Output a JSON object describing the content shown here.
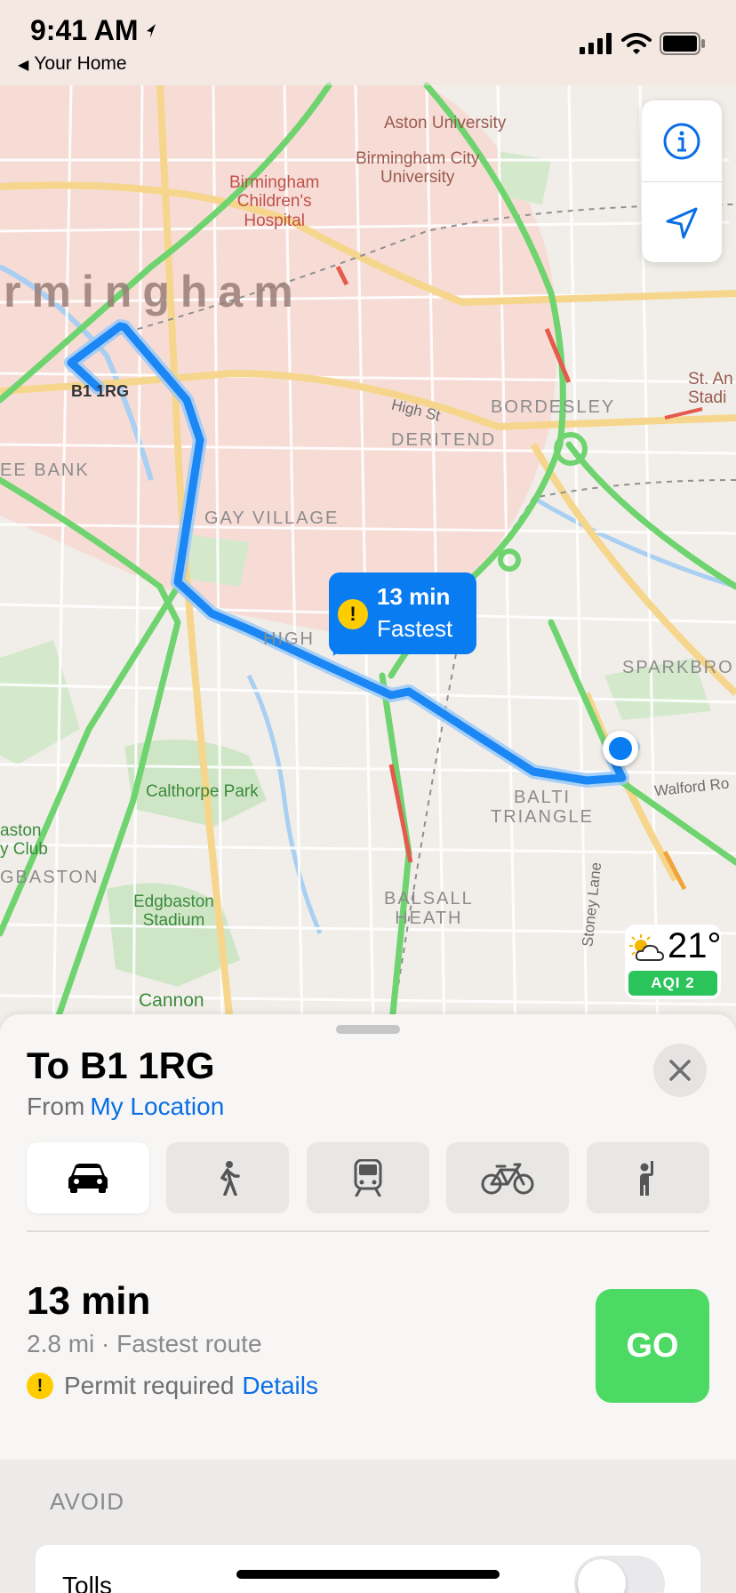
{
  "status_bar": {
    "time": "9:41 AM",
    "back_app": "Your Home",
    "icons": [
      "location-arrow-icon",
      "cellular-signal-icon",
      "wifi-icon",
      "battery-icon"
    ]
  },
  "map": {
    "labels": {
      "city": "rmingham",
      "aston_university": "Aston University",
      "bcu": "Birmingham City\nUniversity",
      "childrens_hospital": "Birmingham\nChildren's\nHospital",
      "dest_code": "B1 1RG",
      "high_st": "High St",
      "bordesley": "BORDESLEY",
      "deritend": "DERITEND",
      "lee_bank": "EE BANK",
      "gay_village": "GAY VILLAGE",
      "highgate": "HIGH",
      "st_andrews": "St. An\nStadi",
      "sparkbrook": "SPARKBRO",
      "calthorpe_park": "Calthorpe Park",
      "walford_road": "Walford Ro",
      "balti_triangle": "BALTI\nTRIANGLE",
      "aston_club": "aston\ny Club",
      "edgbaston": "GBASTON",
      "edgbaston_stadium": "Edgbaston\nStadium",
      "balsall_heath": "BALSALL\nHEATH",
      "stoney_lane": "Stoney Lane",
      "cannon": "Cannon"
    },
    "callout": {
      "time": "13 min",
      "label": "Fastest"
    },
    "weather": {
      "temp": "21°",
      "aqi": "AQI 2",
      "icon": "partly-sunny-icon"
    },
    "controls": [
      "info-icon",
      "location-arrow-icon"
    ],
    "colors": {
      "route": "#1a87f5",
      "traffic_green": "#6fd46f",
      "city_zone": "#f6d6d0"
    }
  },
  "sheet": {
    "title": "To B1 1RG",
    "from_prefix": "From",
    "from_link": "My Location",
    "modes": [
      {
        "name": "drive",
        "icon": "car-icon",
        "active": true
      },
      {
        "name": "walk",
        "icon": "walking-icon",
        "active": false
      },
      {
        "name": "transit",
        "icon": "train-icon",
        "active": false
      },
      {
        "name": "cycle",
        "icon": "bicycle-icon",
        "active": false
      },
      {
        "name": "ride",
        "icon": "hailing-person-icon",
        "active": false
      }
    ],
    "route": {
      "eta": "13 min",
      "details": "2.8 mi · Fastest route",
      "permit_text": "Permit required",
      "permit_link": "Details",
      "go_label": "GO"
    },
    "avoid": {
      "title": "AVOID",
      "tolls_label": "Tolls",
      "tolls_on": false
    }
  }
}
